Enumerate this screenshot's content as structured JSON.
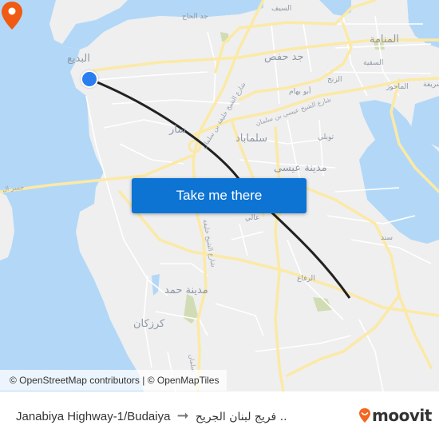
{
  "map": {
    "colors": {
      "water": "#b3d8f7",
      "land": "#efefef",
      "major_road": "#fbe9a6",
      "minor_road": "#ffffff",
      "park": "#d2dcb4",
      "route_line": "#222222",
      "origin": "#2b7ef0",
      "destination": "#f05a12"
    },
    "labels": {
      "budaiya": "البديع",
      "jidd_alhaj": "جد الحاج",
      "alsaif": "السيف",
      "manama": "المنامة",
      "jidhafs": "جد حفص",
      "alsehla": "السقية",
      "alzinj": "الزنج",
      "abu_bahham": "أبو بهام",
      "mahooz": "الماحوز",
      "juffair": "شريفة",
      "saar": "سار",
      "salmabad": "سلماباد",
      "tubli": "توبلي",
      "isa_town": "مدينة عيسى",
      "aali": "عالي",
      "sanad": "سند",
      "riffa": "الرفاع",
      "hamad_town": "مدينة حمد",
      "karzakan": "كرزكان",
      "causeway": "جسر ال",
      "road_isa_bin_salman": "شارع الشيخ عيسى بن سلمان",
      "road_khalifa_bin_salman_1": "شارع الشيخ خليفة بن سلمان",
      "road_khalifa_bin_salman_2": "شارع الشيخ خليفة",
      "road_salman_fragment": "سلمان"
    },
    "origin_icon": "origin-dot-icon",
    "destination_icon": "map-pin-icon"
  },
  "attribution": "© OpenStreetMap contributors | © OpenMapTiles",
  "cta": {
    "label": "Take me there"
  },
  "footer": {
    "origin": "Janabiya Highway-1/Budaiya",
    "arrow": "➞",
    "destination": "فريج لبنان الجريح ..",
    "brand": "moovit",
    "brand_color": "#f26722"
  }
}
